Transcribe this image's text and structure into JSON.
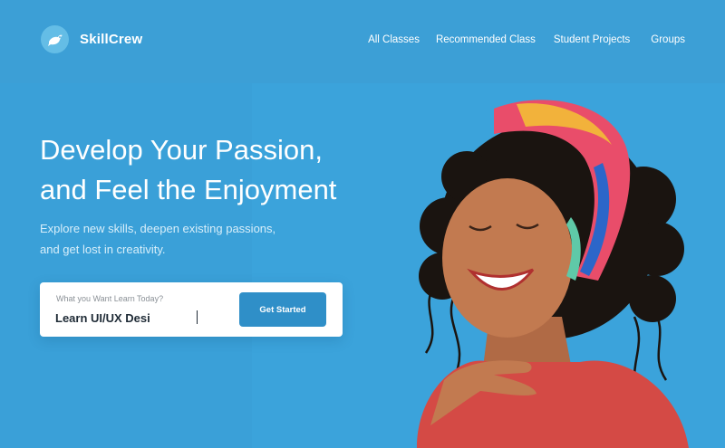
{
  "brand": {
    "name": "SkillCrew",
    "logo_icon": "bird-icon"
  },
  "nav": {
    "items": [
      {
        "label": "All Classes"
      },
      {
        "label": "Recommended Class"
      },
      {
        "label": "Student Projects"
      },
      {
        "label": "Groups"
      }
    ]
  },
  "hero": {
    "headline_line1": "Develop Your Passion,",
    "headline_line2": "and Feel the Enjoyment",
    "sub_line1": "Explore new skills, deepen existing passions,",
    "sub_line2": "and get lost in creativity."
  },
  "search": {
    "label": "What you Want Learn Today?",
    "value": "Learn UI/UX Desi",
    "button_label": "Get Started"
  },
  "colors": {
    "background": "#3aa0d8",
    "accent_button": "#2f8fc8",
    "white": "#ffffff"
  }
}
